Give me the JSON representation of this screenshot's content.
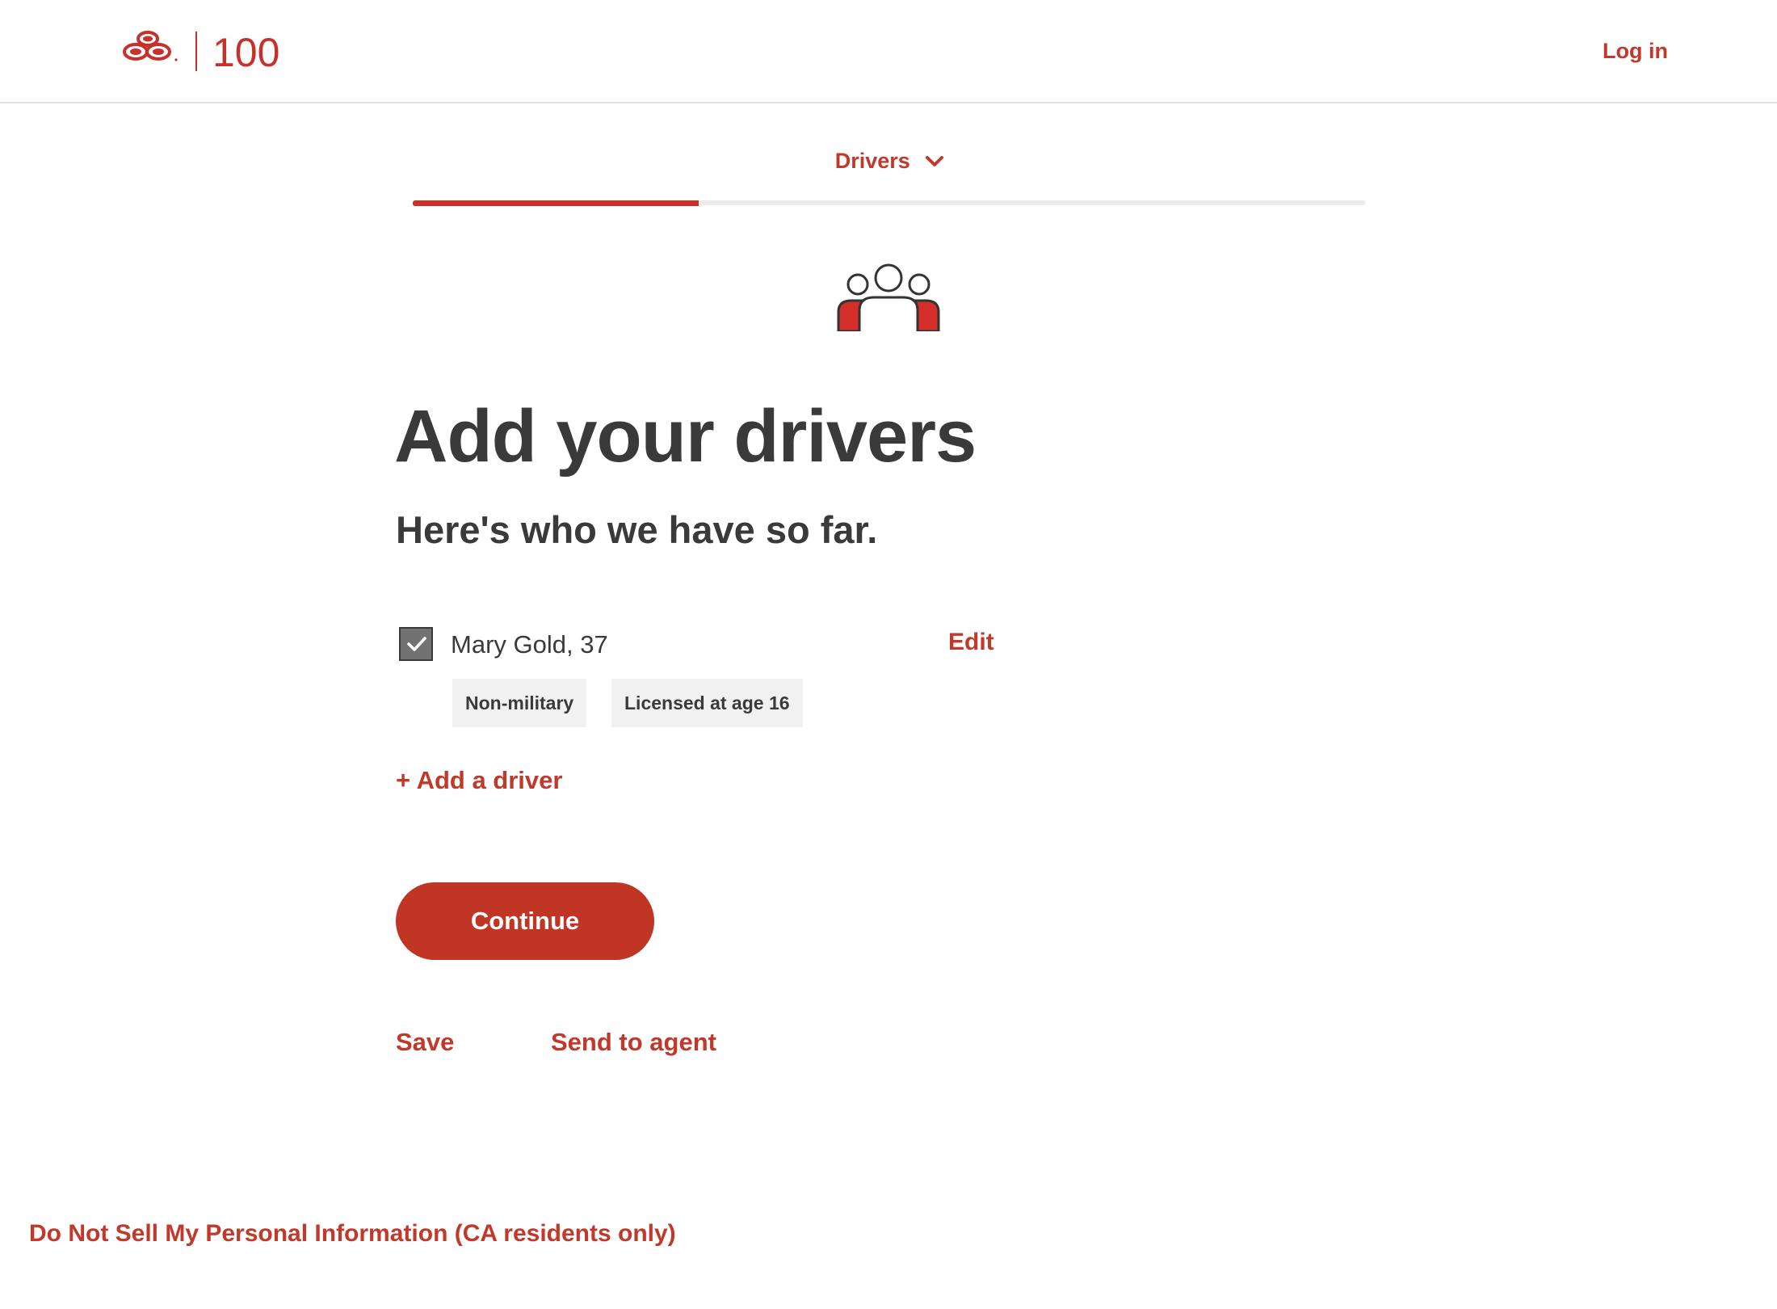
{
  "brand": {
    "logo_icon": "three-ovals-logo-icon",
    "anniversary_mark": "100",
    "color_primary": "#c0392b"
  },
  "header": {
    "login_label": "Log in"
  },
  "progress": {
    "current_step_label": "Drivers",
    "chevron_icon": "chevron-down-icon",
    "completion_fraction": 0.3
  },
  "main": {
    "illustration_icon": "drivers-group-icon",
    "title": "Add your drivers",
    "subtitle": "Here's who we have so far.",
    "drivers": [
      {
        "name": "Mary Gold, 37",
        "selected": true,
        "edit_label": "Edit",
        "tags": [
          "Non-military",
          "Licensed at age 16"
        ]
      }
    ],
    "add_driver_label": "+ Add a driver",
    "continue_label": "Continue",
    "save_label": "Save",
    "send_to_agent_label": "Send to agent"
  },
  "footer": {
    "privacy_label": "Do Not Sell My Personal Information (CA residents only)"
  }
}
